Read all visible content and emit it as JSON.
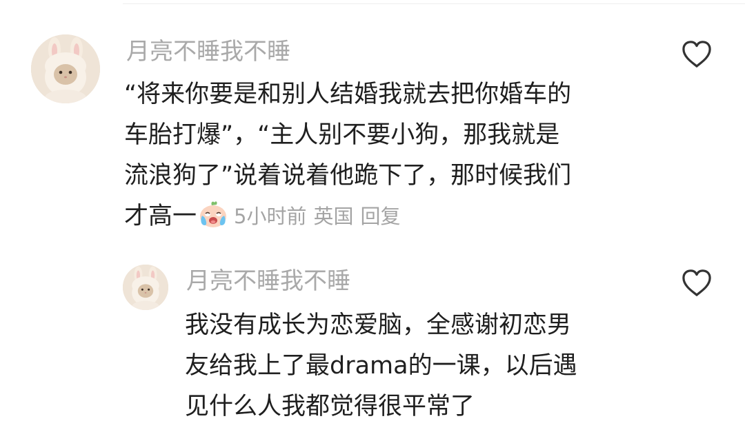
{
  "top_comment": {
    "username": "月亮不睡我不睡",
    "text_lines": [
      "“将来你要是和别人结婚我就去把你婚车的",
      "车胎打爆”，“主人别不要小狗，那我就是",
      "流浪狗了”说着说着他跪下了，那时候我们",
      "才高一"
    ],
    "emoji": "crying-emoji",
    "time": "5小时前",
    "location": "英国",
    "reply_label": "回复",
    "like_icon": "heart-outline-icon"
  },
  "reply_comment": {
    "username": "月亮不睡我不睡",
    "text_lines": [
      "我没有成长为恋爱脑，全感谢初恋男",
      "友给我上了最drama的一课，以后遇",
      "见什么人我都觉得很平常了"
    ],
    "like_icon": "heart-outline-icon"
  },
  "colors": {
    "username": "#a9a9a9",
    "text": "#1f1f1f",
    "meta": "#a4a4a4",
    "icon": "#333333"
  }
}
